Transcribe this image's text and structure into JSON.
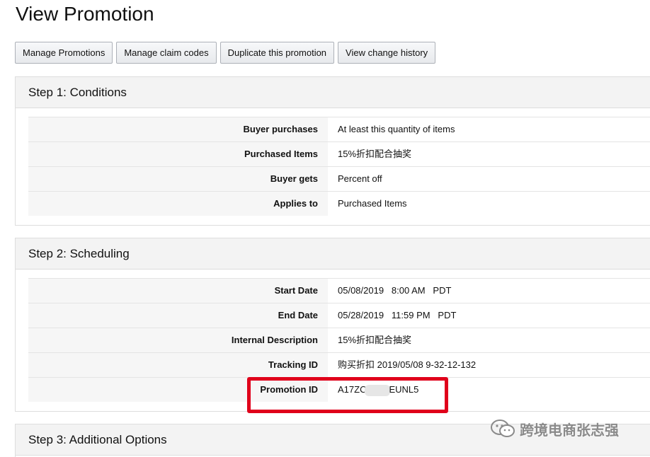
{
  "page": {
    "title": "View Promotion"
  },
  "toolbar": {
    "buttons": [
      "Manage Promotions",
      "Manage claim codes",
      "Duplicate this promotion",
      "View change history"
    ]
  },
  "step1": {
    "title": "Step 1: Conditions",
    "rows": [
      {
        "label": "Buyer purchases",
        "value": "At least this quantity of items"
      },
      {
        "label": "Purchased Items",
        "value": "15%折扣配合抽奖"
      },
      {
        "label": "Buyer gets",
        "value": "Percent off"
      },
      {
        "label": "Applies to",
        "value": "Purchased Items"
      }
    ]
  },
  "step2": {
    "title": "Step 2: Scheduling",
    "rows": [
      {
        "label": "Start Date",
        "value": "05/08/2019   8:00 AM   PDT"
      },
      {
        "label": "End Date",
        "value": "05/28/2019   11:59 PM   PDT"
      },
      {
        "label": "Internal Description",
        "value": "15%折扣配合抽奖"
      },
      {
        "label": "Tracking ID",
        "value": "购买折扣 2019/05/08 9-32-12-132"
      },
      {
        "label": "Promotion ID",
        "value_prefix": "A17ZC",
        "value_suffix": "EUNL5"
      }
    ]
  },
  "step3": {
    "title": "Step 3: Additional Options"
  },
  "watermark": {
    "text": "跨境电商张志强",
    "icon": "wechat-icon"
  },
  "colors": {
    "highlight": "#e0001b",
    "header_bg": "#f3f3f3",
    "label_bg": "#f6f6f6"
  }
}
